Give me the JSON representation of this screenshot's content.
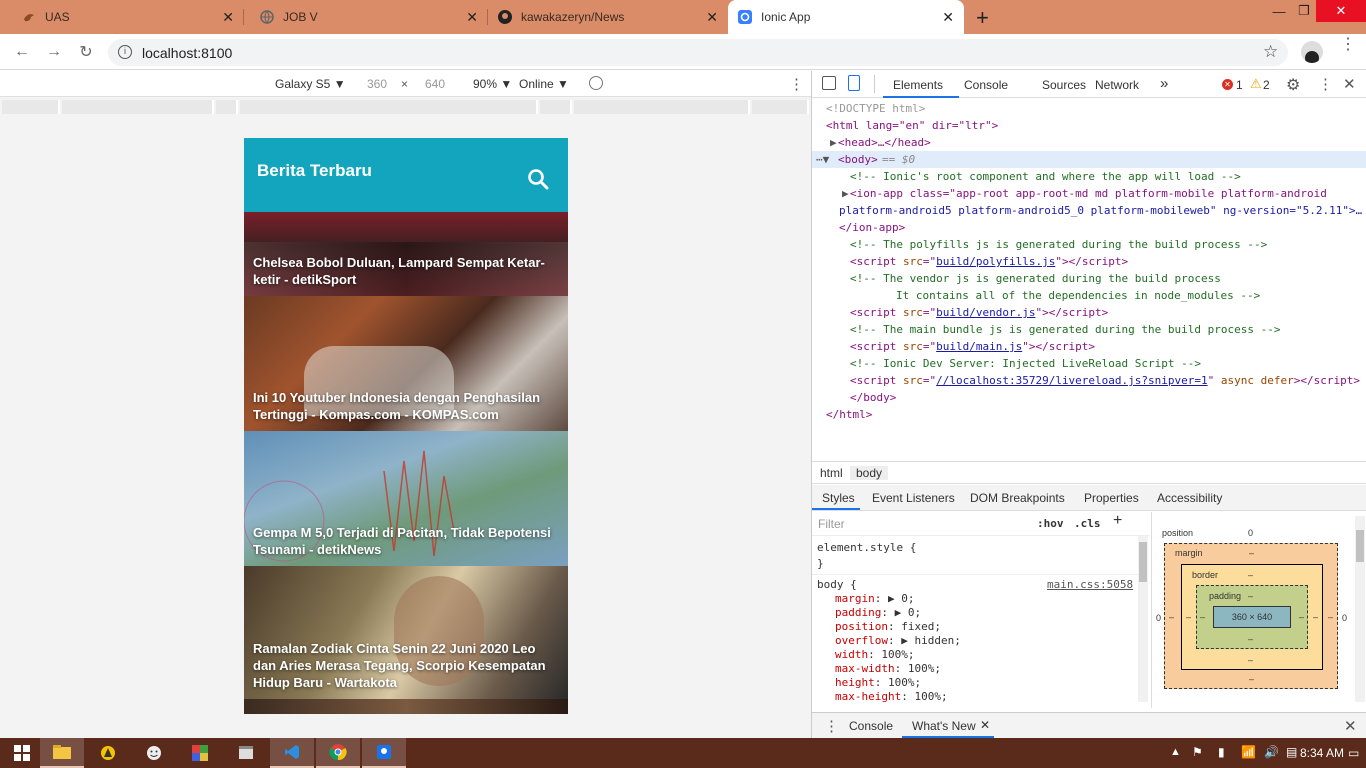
{
  "browser": {
    "tabs": [
      {
        "title": "UAS",
        "icon": "bird-icon",
        "active": false
      },
      {
        "title": "JOB V",
        "icon": "globe-icon",
        "active": false
      },
      {
        "title": "kawakazeryn/News",
        "icon": "github-icon",
        "active": false
      },
      {
        "title": "Ionic App",
        "icon": "ionic-icon",
        "active": true
      }
    ],
    "new_tab": "+",
    "url": "localhost:8100"
  },
  "device_toolbar": {
    "device": "Galaxy S5 ▼",
    "width": "360",
    "times": "×",
    "height": "640",
    "zoom": "90% ▼",
    "network": "Online ▼"
  },
  "app": {
    "title": "Berita Terbaru",
    "colors": {
      "header": "#13a5be"
    },
    "articles": [
      {
        "title": "Chelsea Bobol Duluan, Lampard Sempat Ketar-ketir - detikSport"
      },
      {
        "title": "Ini 10 Youtuber Indonesia dengan Penghasilan Tertinggi - Kompas.com - KOMPAS.com"
      },
      {
        "title": "Gempa M 5,0 Terjadi di Pacitan, Tidak Bepotensi Tsunami - detikNews"
      },
      {
        "title": "Ramalan Zodiak Cinta Senin 22 Juni 2020 Leo dan Aries Merasa Tegang, Scorpio Kesempatan Hidup Baru - Wartakota"
      }
    ]
  },
  "devtools": {
    "tabs": [
      "Elements",
      "Console",
      "Sources",
      "Network",
      "»"
    ],
    "errors": "1",
    "warnings": "2",
    "dom": {
      "doctype": "<!DOCTYPE html>",
      "html_open": "<html lang=\"en\" dir=\"ltr\">",
      "head": "<head>…</head>",
      "body_open": "<body>",
      "body_selected": "== $0",
      "c1": "<!-- Ionic's root component and where the app will load -->",
      "ionapp_1": "<ion-app class=\"app-root app-root-md md platform-mobile platform-android",
      "ionapp_2": "platform-android5 platform-android5_0 platform-mobileweb\" ng-version=\"5.2.11\">…",
      "ionapp_close": "</ion-app>",
      "c2": "<!-- The polyfills js is generated during the build process -->",
      "s1_src": "build/polyfills.js",
      "c3a": "<!-- The vendor js is generated during the build process",
      "c3b": "It contains all of the dependencies in node_modules -->",
      "s2_src": "build/vendor.js",
      "c4": "<!-- The main bundle js is generated during the build process -->",
      "s3_src": "build/main.js",
      "c5": "<!-- Ionic Dev Server: Injected LiveReload Script -->",
      "s4_src": "//localhost:35729/livereload.js?snipver=1",
      "s4_rest": "async defer",
      "body_close": "</body>",
      "html_close": "</html>"
    },
    "breadcrumbs": [
      "html",
      "body"
    ],
    "subtabs": [
      "Styles",
      "Event Listeners",
      "DOM Breakpoints",
      "Properties",
      "Accessibility"
    ],
    "filter_placeholder": "Filter",
    "hov": ":hov",
    "cls": ".cls",
    "element_style": "element.style {",
    "close_brace": "}",
    "rule_selector": "body {",
    "rule_source": "main.css:5058",
    "props": [
      {
        "name": "margin",
        "value": "▶ 0;"
      },
      {
        "name": "padding",
        "value": "▶ 0;"
      },
      {
        "name": "position",
        "value": "fixed;"
      },
      {
        "name": "overflow",
        "value": "▶ hidden;"
      },
      {
        "name": "width",
        "value": "100%;"
      },
      {
        "name": "max-width",
        "value": "100%;"
      },
      {
        "name": "height",
        "value": "100%;"
      },
      {
        "name": "max-height",
        "value": "100%;"
      }
    ],
    "box_model": {
      "position_label": "position",
      "position_value": "0",
      "margin_label": "margin",
      "border_label": "border",
      "padding_label": "padding",
      "dash": "–",
      "zero": "0",
      "content": "360 × 640"
    },
    "drawer_tabs": [
      "Console",
      "What's New"
    ]
  },
  "taskbar": {
    "clock": "8:34 AM"
  }
}
